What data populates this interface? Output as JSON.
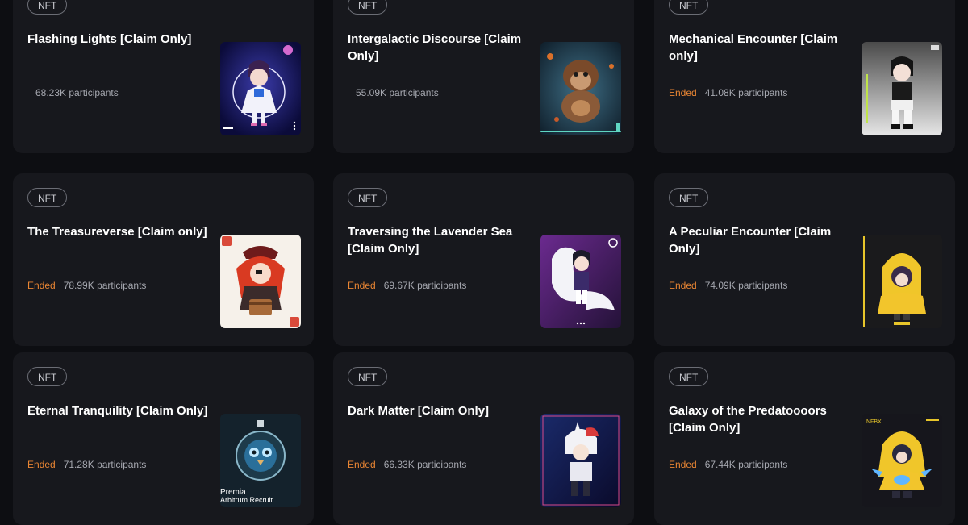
{
  "cards": [
    {
      "tag": "NFT",
      "title": "Flashing Lights [Claim Only]",
      "status": "",
      "participants": "68.23K participants",
      "image": "anime-girl-white-dress-artwork"
    },
    {
      "tag": "NFT",
      "title": "Intergalactic Discourse [Claim Only]",
      "status": "",
      "participants": "55.09K participants",
      "image": "space-ape-artwork"
    },
    {
      "tag": "NFT",
      "title": "Mechanical Encounter [Claim only]",
      "status": "Ended",
      "participants": "41.08K participants",
      "image": "mech-girl-artwork"
    },
    {
      "tag": "NFT",
      "title": "The Treasureverse [Claim only]",
      "status": "Ended",
      "participants": "78.99K participants",
      "image": "pirate-girl-treasure-card-artwork"
    },
    {
      "tag": "NFT",
      "title": "Traversing the Lavender Sea [Claim Only]",
      "status": "Ended",
      "participants": "69.67K participants",
      "image": "girl-with-whale-artwork"
    },
    {
      "tag": "NFT",
      "title": "A Peculiar Encounter [Claim Only]",
      "status": "Ended",
      "participants": "74.09K participants",
      "image": "yellow-raincoat-girl-artwork"
    },
    {
      "tag": "NFT",
      "title": "Eternal Tranquility [Claim Only]",
      "status": "Ended",
      "participants": "71.28K participants",
      "image": "premia-owl-emblem-artwork",
      "image_caption": [
        "Premia",
        "Arbitrum Recruit"
      ]
    },
    {
      "tag": "NFT",
      "title": "Dark Matter [Claim Only]",
      "status": "Ended",
      "participants": "66.33K participants",
      "image": "unicorn-hood-character-artwork"
    },
    {
      "tag": "NFT",
      "title": "Galaxy of the Predatoooors [Claim Only]",
      "status": "Ended",
      "participants": "67.44K participants",
      "image": "yellow-hood-character-artwork",
      "image_caption": [
        "NFBX"
      ]
    }
  ]
}
